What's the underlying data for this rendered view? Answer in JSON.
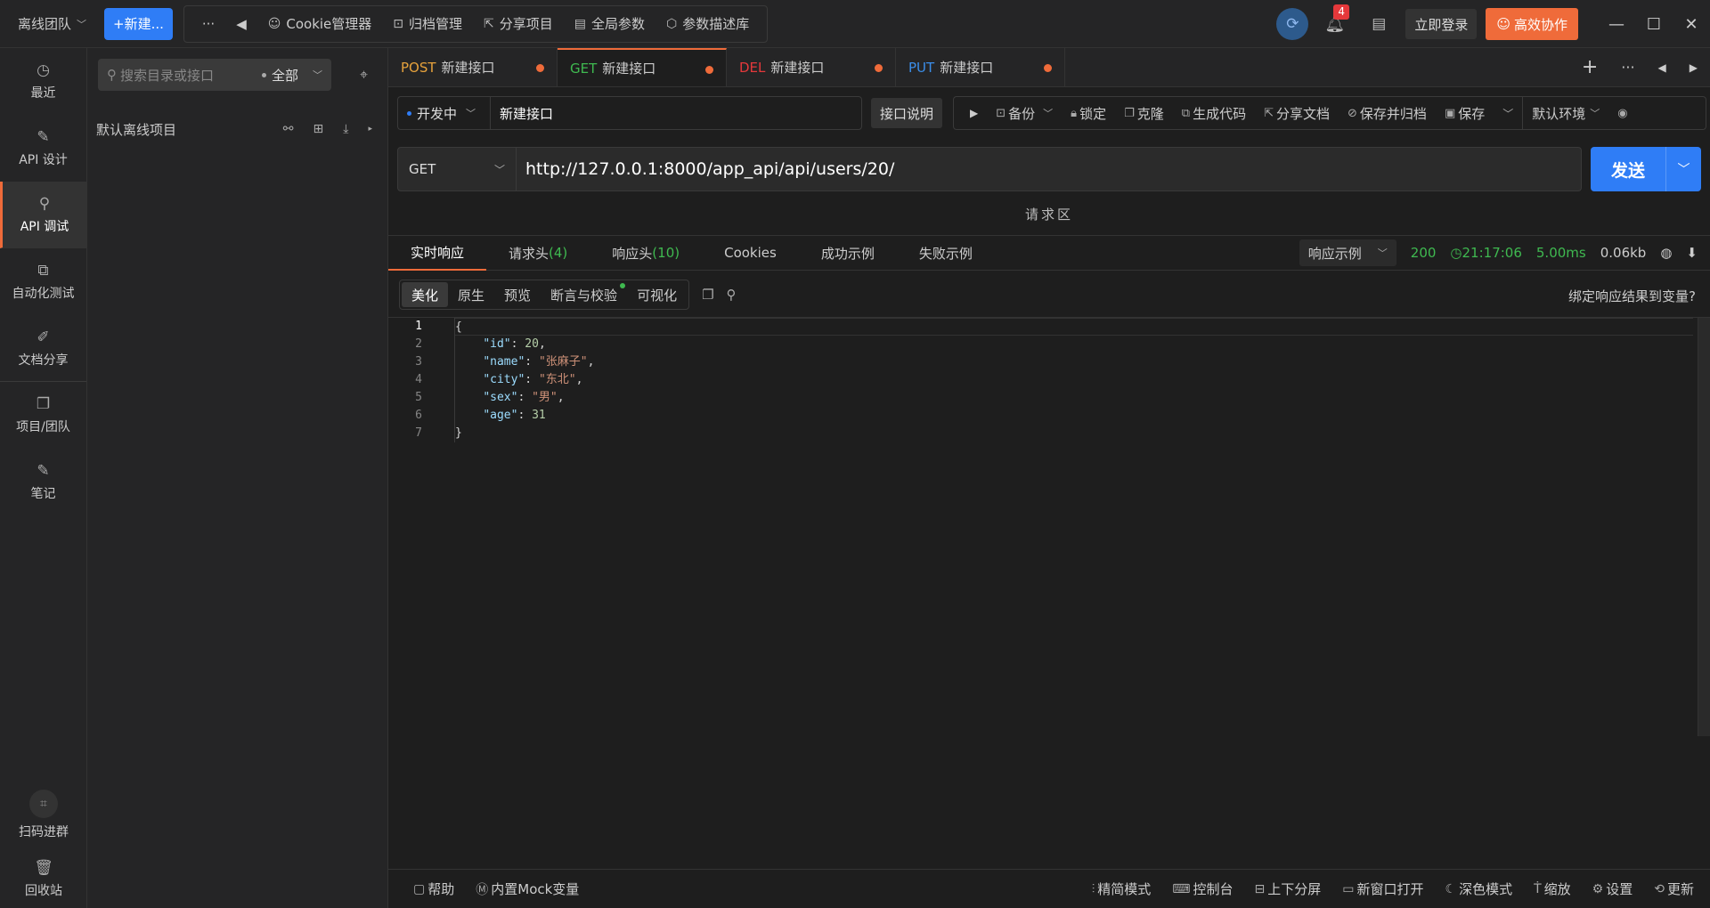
{
  "topbar": {
    "team": "离线团队",
    "new_btn": "+新建...",
    "more": "···",
    "back": "◀",
    "tools": [
      {
        "icon": "cookie-icon",
        "glyph": "☺",
        "label": "Cookie管理器"
      },
      {
        "icon": "archive-icon",
        "glyph": "⊡",
        "label": "归档管理"
      },
      {
        "icon": "share-icon",
        "glyph": "⇱",
        "label": "分享项目"
      },
      {
        "icon": "params-icon",
        "glyph": "▤",
        "label": "全局参数"
      },
      {
        "icon": "library-icon",
        "glyph": "⬡",
        "label": "参数描述库"
      }
    ],
    "notif_count": "4",
    "login": "立即登录",
    "collab": "高效协作"
  },
  "leftnav": {
    "items": [
      {
        "icon": "recent-icon",
        "glyph": "◷",
        "label": "最近"
      },
      {
        "icon": "api-design-icon",
        "glyph": "✎",
        "label": "API 设计"
      },
      {
        "icon": "api-debug-icon",
        "glyph": "⚲",
        "label": "API 调试"
      },
      {
        "icon": "auto-test-icon",
        "glyph": "⧉",
        "label": "自动化测试"
      },
      {
        "icon": "doc-share-icon",
        "glyph": "✐",
        "label": "文档分享"
      },
      {
        "icon": "project-team-icon",
        "glyph": "❐",
        "label": "项目/团队"
      },
      {
        "icon": "notes-icon",
        "glyph": "✎",
        "label": "笔记"
      }
    ],
    "scan": "扫码进群",
    "trash": "回收站"
  },
  "dirpanel": {
    "search_placeholder": "搜索目录或接口",
    "filter": "全部",
    "project": "默认离线项目"
  },
  "tabs": [
    {
      "method": "POST",
      "color": "#e6a23c",
      "name": "新建接口",
      "active": false
    },
    {
      "method": "GET",
      "color": "#3fb950",
      "name": "新建接口",
      "active": true
    },
    {
      "method": "DEL",
      "color": "#e5383b",
      "name": "新建接口",
      "active": false
    },
    {
      "method": "PUT",
      "color": "#3b8eea",
      "name": "新建接口",
      "active": false
    }
  ],
  "request": {
    "status": "开发中",
    "name": "新建接口",
    "desc_btn": "接口说明",
    "actions": {
      "backup": "备份",
      "lock": "锁定",
      "clone": "克隆",
      "gen_code": "生成代码",
      "share_doc": "分享文档",
      "save_archive": "保存并归档",
      "save": "保存",
      "env": "默认环境"
    },
    "method": "GET",
    "url": "http://127.0.0.1:8000/app_api/api/users/20/",
    "send": "发送",
    "zone_label": "请求区"
  },
  "response": {
    "tabs": {
      "realtime": "实时响应",
      "req_headers": "请求头",
      "req_headers_count": "(4)",
      "resp_headers": "响应头",
      "resp_headers_count": "(10)",
      "cookies": "Cookies",
      "success_example": "成功示例",
      "fail_example": "失败示例"
    },
    "example_select": "响应示例",
    "status_code": "200",
    "time": "21:17:06",
    "duration": "5.00ms",
    "size": "0.06kb",
    "subtabs": {
      "beautify": "美化",
      "raw": "原生",
      "preview": "预览",
      "assert": "断言与校验",
      "visualize": "可视化"
    },
    "bind_var": "绑定响应结果到变量?",
    "body": {
      "id": "20",
      "name": "\"张麻子\"",
      "city": "\"东北\"",
      "sex": "\"男\"",
      "age": "31"
    },
    "line_numbers": [
      "1",
      "2",
      "3",
      "4",
      "5",
      "6",
      "7"
    ]
  },
  "footer": {
    "help": "帮助",
    "mock": "内置Mock变量",
    "simple_mode": "精简模式",
    "console": "控制台",
    "split": "上下分屏",
    "new_window": "新窗口打开",
    "dark_mode": "深色模式",
    "zoom": "缩放",
    "settings": "设置",
    "update": "更新"
  }
}
